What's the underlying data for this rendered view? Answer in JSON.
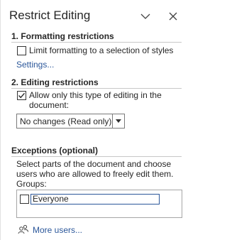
{
  "pane": {
    "title": "Restrict Editing",
    "options_icon": "chevron-down-icon",
    "close_icon": "close-icon"
  },
  "formatting": {
    "heading": "1. Formatting restrictions",
    "checkbox_label": "Limit formatting to a selection of styles",
    "checked": false,
    "settings_link": "Settings..."
  },
  "editing": {
    "heading": "2. Editing restrictions",
    "checkbox_label_line1": "Allow only this type of editing in the",
    "checkbox_label_line2": "document:",
    "checked": true,
    "select_value": "No changes (Read only)"
  },
  "exceptions": {
    "heading": "Exceptions (optional)",
    "description_line1": "Select parts of the document and choose",
    "description_line2": "users who are allowed to freely edit them.",
    "groups_label": "Groups:",
    "groups": [
      {
        "name": "Everyone",
        "checked": false
      }
    ],
    "more_users_link": "More users...",
    "more_users_icon": "users-icon"
  },
  "colors": {
    "link": "#2b579a",
    "text": "#262626",
    "rule": "#c8c8c8"
  }
}
